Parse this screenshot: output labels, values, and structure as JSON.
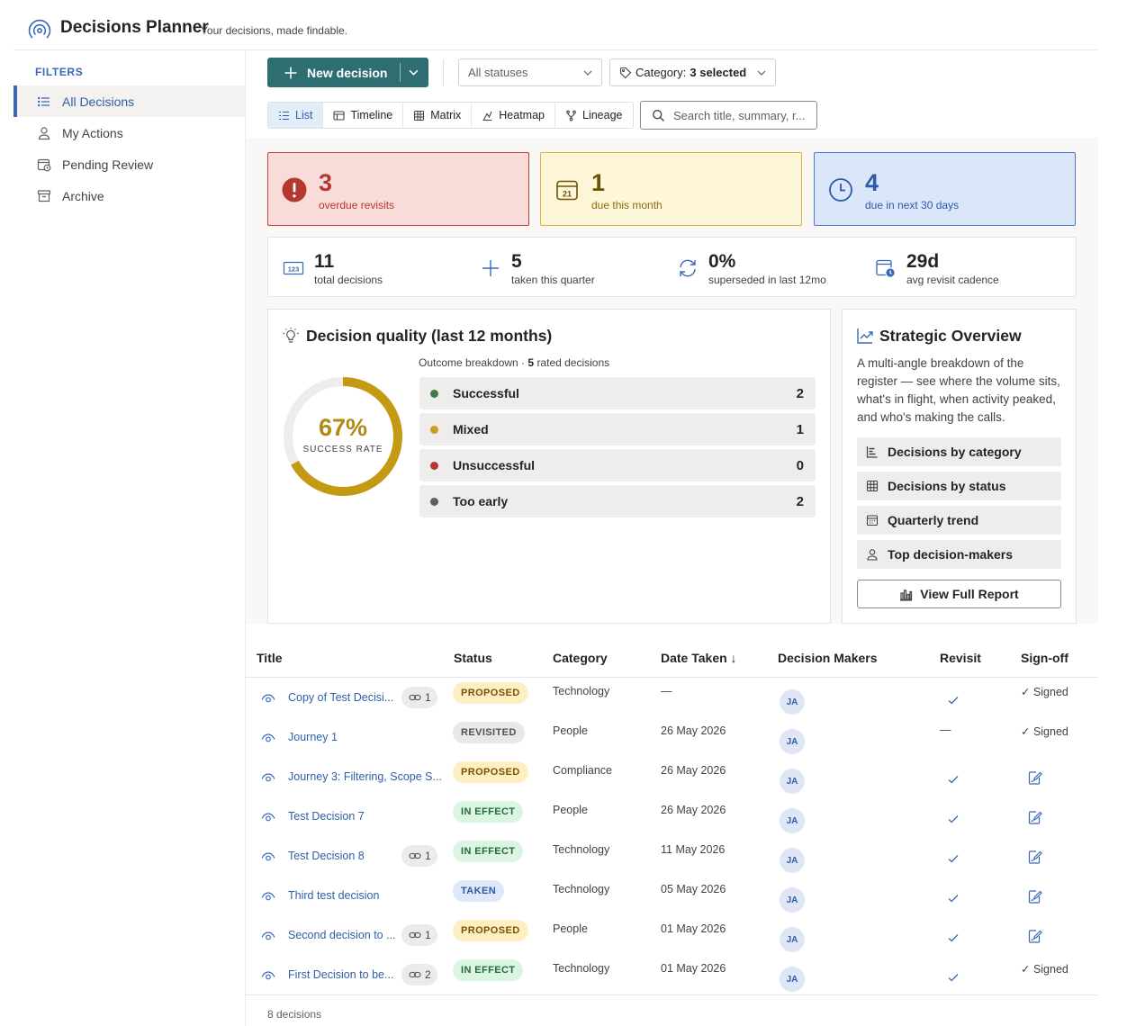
{
  "app": {
    "title": "Decisions Planner",
    "tagline": "Your decisions, made findable.",
    "logo_icon": "broadcast-icon",
    "accent": "#3a68b8"
  },
  "sidebar": {
    "section_label": "FILTERS",
    "items": [
      {
        "label": "All Decisions",
        "icon": "list-icon",
        "active": true
      },
      {
        "label": "My Actions",
        "icon": "person-icon",
        "active": false
      },
      {
        "label": "Pending Review",
        "icon": "calendar-clock-icon",
        "active": false
      },
      {
        "label": "Archive",
        "icon": "archive-icon",
        "active": false
      }
    ]
  },
  "toolbar": {
    "new_button": "New decision",
    "new_button_color": "#2e6e73",
    "status_select": "All statuses",
    "category_select_prefix": "Category:",
    "category_select_value": "3 selected"
  },
  "views": {
    "tabs": [
      {
        "label": "List",
        "icon": "list-icon",
        "active": true
      },
      {
        "label": "Timeline",
        "icon": "timeline-icon",
        "active": false
      },
      {
        "label": "Matrix",
        "icon": "grid-icon",
        "active": false
      },
      {
        "label": "Heatmap",
        "icon": "heatmap-icon",
        "active": false
      },
      {
        "label": "Lineage",
        "icon": "branch-icon",
        "active": false
      }
    ],
    "search_placeholder": "Search title, summary, r..."
  },
  "kpis": [
    {
      "value": "3",
      "label": "overdue revisits",
      "icon": "alert-icon",
      "tone": "red"
    },
    {
      "value": "1",
      "label": "due this month",
      "icon": "calendar-icon",
      "tone": "yellow"
    },
    {
      "value": "4",
      "label": "due in next 30 days",
      "icon": "clock-icon",
      "tone": "blue"
    }
  ],
  "stats": [
    {
      "value": "11",
      "label": "total decisions",
      "icon": "number-icon"
    },
    {
      "value": "5",
      "label": "taken this quarter",
      "icon": "plus-icon"
    },
    {
      "value": "0%",
      "label": "superseded in last 12mo",
      "icon": "refresh-icon"
    },
    {
      "value": "29d",
      "label": "avg revisit cadence",
      "icon": "calendar-clock-icon"
    }
  ],
  "quality": {
    "title": "Decision quality (last 12 months)",
    "success_rate": "67%",
    "success_rate_fraction": 0.67,
    "success_label": "SUCCESS RATE",
    "breakdown_prefix": "Outcome breakdown ·",
    "breakdown_count": "5",
    "breakdown_suffix": "rated decisions",
    "outcomes": [
      {
        "label": "Successful",
        "count": "2",
        "color": "#3f7a4a"
      },
      {
        "label": "Mixed",
        "count": "1",
        "color": "#c8a01a"
      },
      {
        "label": "Unsuccessful",
        "count": "0",
        "color": "#b3382f"
      },
      {
        "label": "Too early",
        "count": "2",
        "color": "#5f5f5f"
      }
    ]
  },
  "strategic": {
    "title": "Strategic Overview",
    "description": "A multi-angle breakdown of the register — see where the volume sits, what's in flight, when activity peaked, and who's making the calls.",
    "buttons": [
      {
        "label": "Decisions by category",
        "icon": "bar-chart-icon"
      },
      {
        "label": "Decisions by status",
        "icon": "grid-icon"
      },
      {
        "label": "Quarterly trend",
        "icon": "calendar-icon"
      },
      {
        "label": "Top decision-makers",
        "icon": "person-icon"
      }
    ],
    "full_report": "View Full Report"
  },
  "table": {
    "columns": [
      "Title",
      "Status",
      "Category",
      "Date Taken ↓",
      "Decision Makers",
      "Revisit",
      "Sign-off"
    ],
    "rows": [
      {
        "title": "Copy of Test Decisi...",
        "links": "1",
        "status": "PROPOSED",
        "status_kind": "proposed",
        "category": "Technology",
        "date": "—",
        "makers": "JA",
        "revisit": true,
        "signoff": "✓ Signed"
      },
      {
        "title": "Journey 1",
        "links": "",
        "status": "REVISITED",
        "status_kind": "revisited",
        "category": "People",
        "date": "26 May 2026",
        "makers": "JA",
        "revisit": false,
        "signoff": "✓ Signed"
      },
      {
        "title": "Journey 3: Filtering, Scope S...",
        "links": "",
        "status": "PROPOSED",
        "status_kind": "proposed",
        "category": "Compliance",
        "date": "26 May 2026",
        "makers": "JA",
        "revisit": true,
        "signoff": ""
      },
      {
        "title": "Test Decision 7",
        "links": "",
        "status": "IN EFFECT",
        "status_kind": "ineffect",
        "category": "People",
        "date": "26 May 2026",
        "makers": "JA",
        "revisit": true,
        "signoff": ""
      },
      {
        "title": "Test Decision 8",
        "links": "1",
        "status": "IN EFFECT",
        "status_kind": "ineffect",
        "category": "Technology",
        "date": "11 May 2026",
        "makers": "JA",
        "revisit": true,
        "signoff": ""
      },
      {
        "title": "Third test decision",
        "links": "",
        "status": "TAKEN",
        "status_kind": "taken",
        "category": "Technology",
        "date": "05 May 2026",
        "makers": "JA",
        "revisit": true,
        "signoff": ""
      },
      {
        "title": "Second decision to ...",
        "links": "1",
        "status": "PROPOSED",
        "status_kind": "proposed",
        "category": "People",
        "date": "01 May 2026",
        "makers": "JA",
        "revisit": true,
        "signoff": ""
      },
      {
        "title": "First Decision to be...",
        "links": "2",
        "status": "IN EFFECT",
        "status_kind": "ineffect",
        "category": "Technology",
        "date": "01 May 2026",
        "makers": "JA",
        "revisit": true,
        "signoff": "✓ Signed"
      }
    ],
    "revisit_empty": "—",
    "footer": "8 decisions"
  }
}
